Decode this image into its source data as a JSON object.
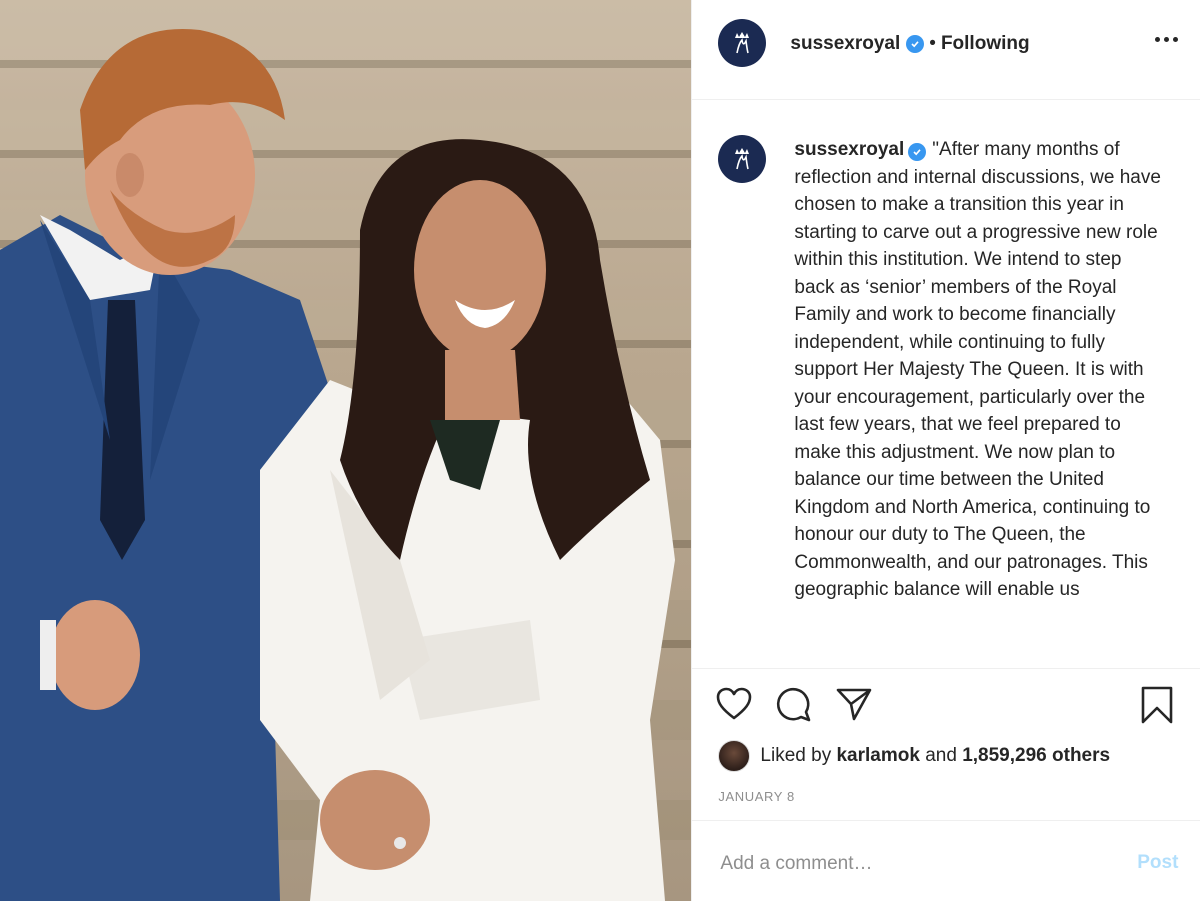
{
  "post": {
    "username": "sussexroyal",
    "verified": true,
    "separator": "•",
    "follow_state": "Following",
    "avatar_icon": "royal-monogram-icon",
    "caption": "\"After many months of reflection and internal discussions, we have chosen to make a transition this year in starting to carve out a progressive new role within this institution. We intend to step back as ‘senior’ members of the Royal Family and work to become financially independent, while continuing to fully support Her Majesty The Queen. It is with your encouragement, particularly over the last few years, that we feel prepared to make this adjustment. We now plan to balance our time between the United Kingdom and North America, continuing to honour our duty to The Queen, the Commonwealth, and our patronages. This geographic balance will enable us",
    "likes": {
      "prefix": "Liked by",
      "user": "karlamok",
      "connector": "and",
      "count": "1,859,296 others"
    },
    "date": "JANUARY 8"
  },
  "comment": {
    "placeholder": "Add a comment…",
    "post_label": "Post"
  },
  "icons": {
    "like": "heart-icon",
    "comment": "comment-bubble-icon",
    "share": "paper-plane-icon",
    "save": "bookmark-icon",
    "more": "more-options-icon",
    "verified": "verified-badge-icon"
  },
  "colors": {
    "verified_blue": "#3897f0",
    "post_button_disabled": "#b2dffc",
    "muted_text": "#8e8e8e",
    "divider": "#efefef"
  }
}
